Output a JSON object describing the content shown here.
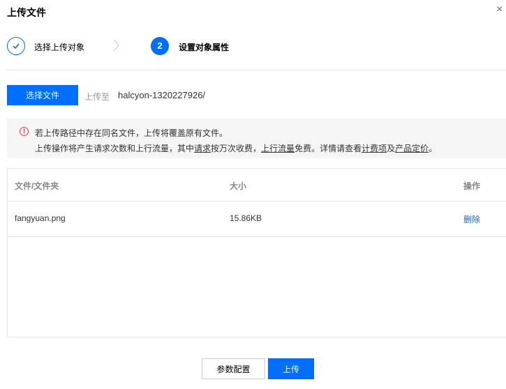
{
  "dialog": {
    "title": "上传文件",
    "close_glyph": "×"
  },
  "steps": [
    {
      "label": "选择上传对象",
      "icon": "check-icon",
      "status": "completed"
    },
    {
      "label": "设置对象属性",
      "number": "2",
      "status": "active"
    }
  ],
  "upload": {
    "select_button": "选择文件",
    "upload_to_label": "上传至",
    "path": "halcyon-1320227926/"
  },
  "notice": {
    "icon": "warning-icon",
    "line1": "若上传路径中存在同名文件，上传将覆盖原有文件。",
    "line2": {
      "t1": "上传操作将产生请求次数和上行流量，其中",
      "link_requests": "请求",
      "t2": "按万次收费，",
      "link_upstream": "上行流量",
      "t3": "免费。详情请查看",
      "link_billing": "计费项",
      "t4": "及",
      "link_pricing": "产品定价",
      "t5": "。"
    }
  },
  "table": {
    "headers": {
      "name": "文件/文件夹",
      "size": "大小",
      "action": "操作"
    },
    "rows": [
      {
        "name": "fangyuan.png",
        "size": "15.86KB",
        "action": "删除"
      }
    ]
  },
  "footer": {
    "params_button": "参数配置",
    "upload_button": "上传"
  },
  "colors": {
    "primary": "#006eff",
    "warning": "#e54545"
  }
}
